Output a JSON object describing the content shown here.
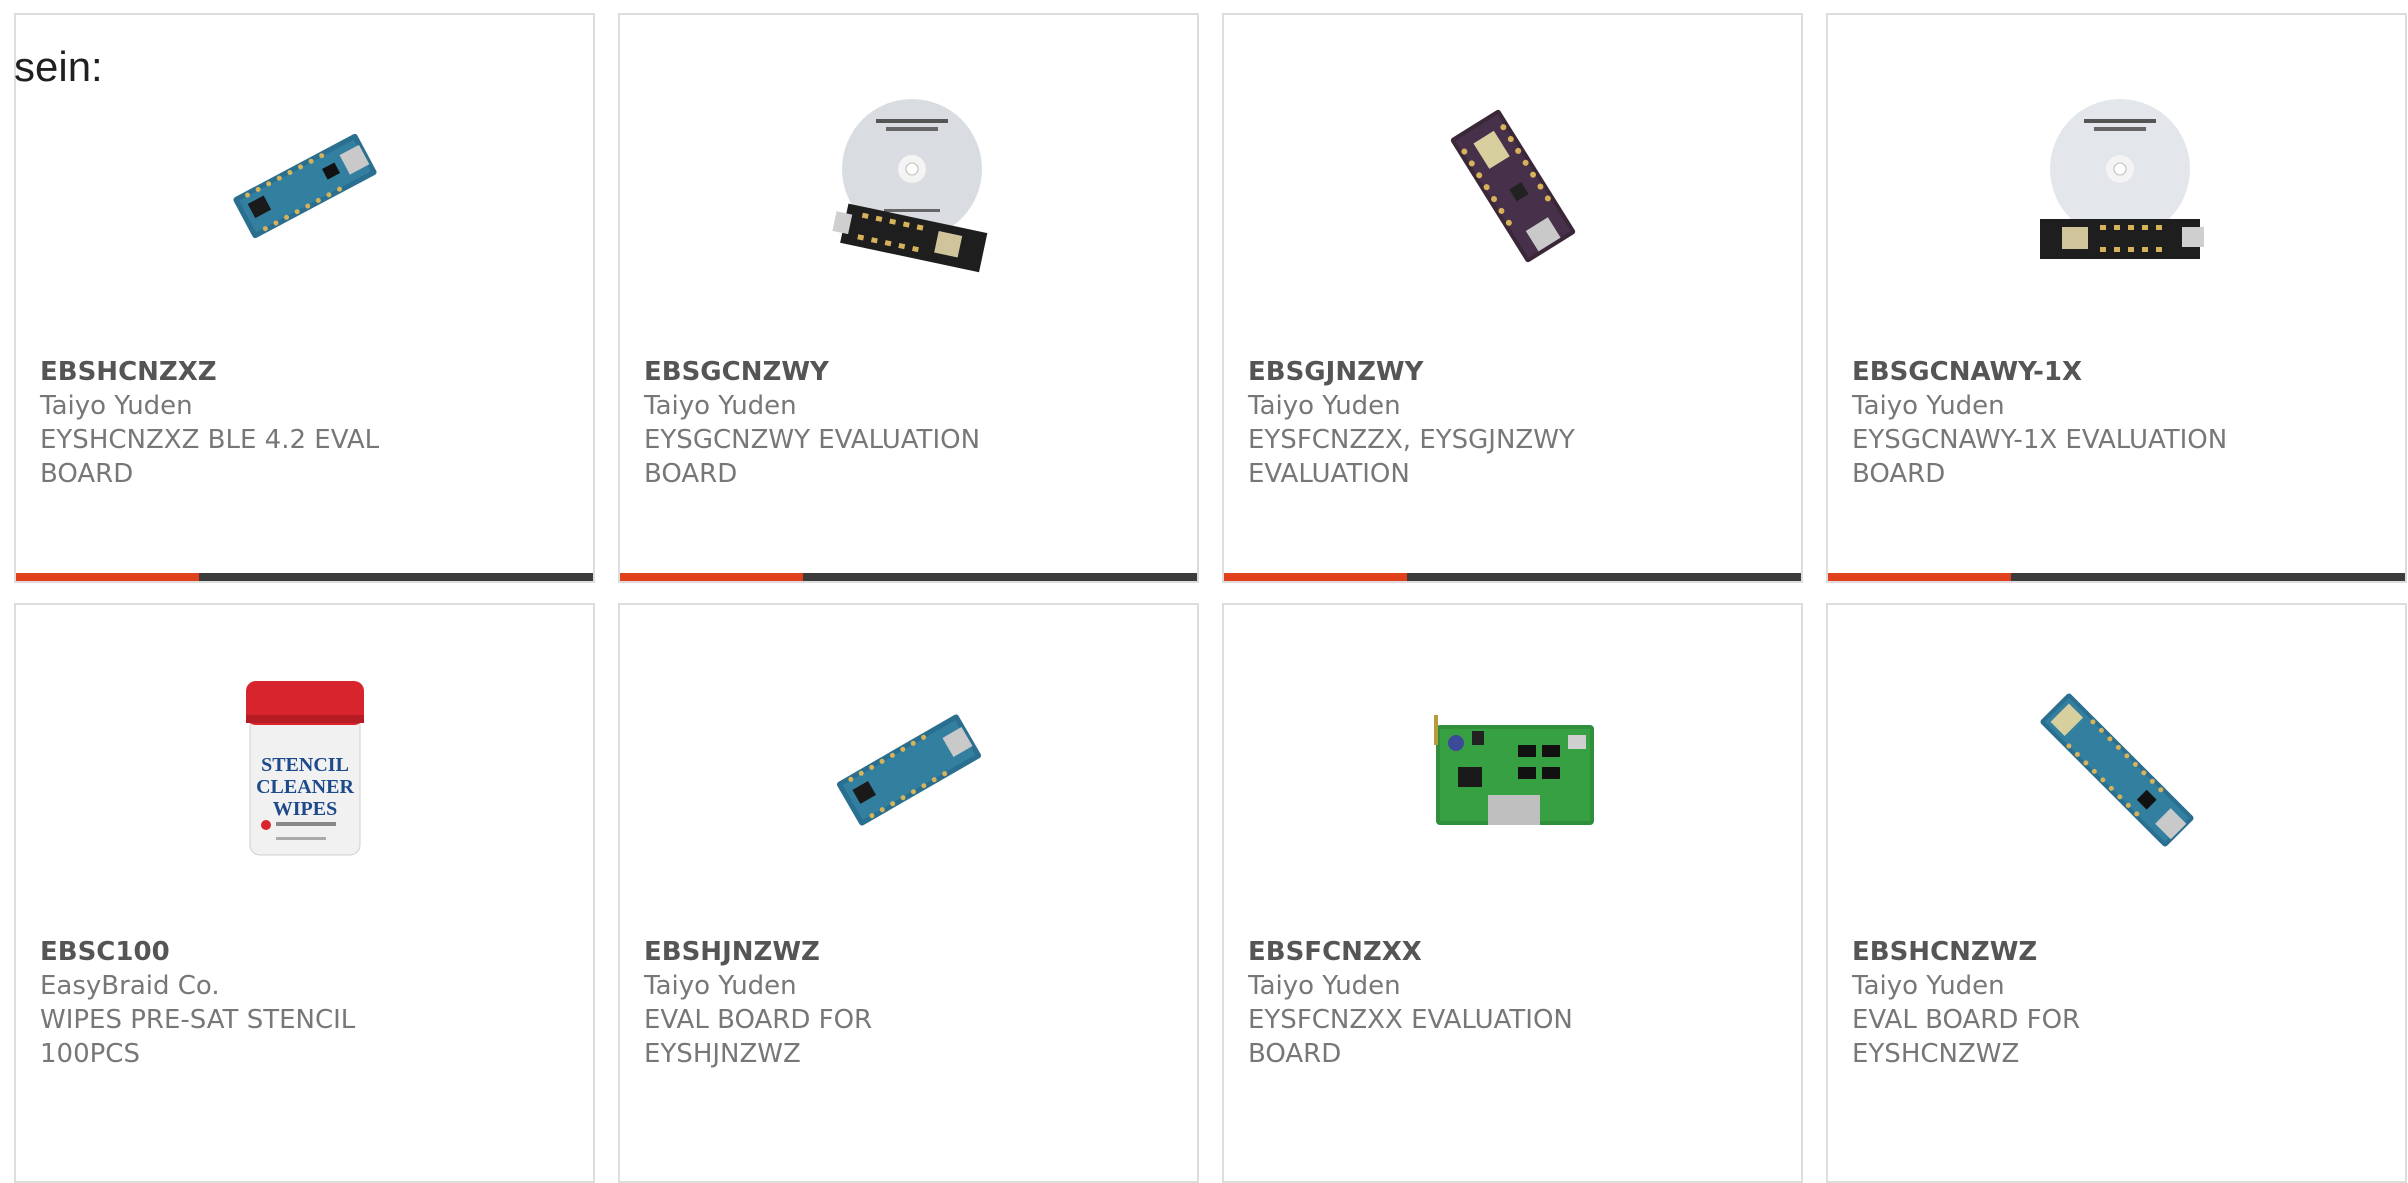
{
  "intro_text": "sein:",
  "colors": {
    "accent": "#e0401c",
    "bar": "#3c3c3c",
    "border": "#dddddd",
    "text": "#777777",
    "part_number": "#555555"
  },
  "products": [
    {
      "part_number": "EBSHCNZXZ",
      "manufacturer": "Taiyo Yuden",
      "description": "EYSHCNZXZ BLE 4.2 EVAL BOARD",
      "image_icon": "blue-eval-board-image",
      "show_accent_bar": true
    },
    {
      "part_number": "EBSGCNZWY",
      "manufacturer": "Taiyo Yuden",
      "description": "EYSGCNZWY EVALUATION BOARD",
      "image_icon": "cd-and-board-image",
      "show_accent_bar": true
    },
    {
      "part_number": "EBSGJNZWY",
      "manufacturer": "Taiyo Yuden",
      "description": "EYSFCNZZX, EYSGJNZWY EVALUATION",
      "image_icon": "purple-eval-board-image",
      "show_accent_bar": true
    },
    {
      "part_number": "EBSGCNAWY-1X",
      "manufacturer": "Taiyo Yuden",
      "description": "EYSGCNAWY-1X EVALUATION BOARD",
      "image_icon": "cd-and-board-image",
      "show_accent_bar": true
    },
    {
      "part_number": "EBSC100",
      "manufacturer": "EasyBraid Co.",
      "description": "WIPES PRE-SAT STENCIL 100PCS",
      "image_icon": "stencil-wipes-tub-image",
      "show_accent_bar": false
    },
    {
      "part_number": "EBSHJNZWZ",
      "manufacturer": "Taiyo Yuden",
      "description": "EVAL BOARD FOR EYSHJNZWZ",
      "image_icon": "blue-eval-board-image",
      "show_accent_bar": false
    },
    {
      "part_number": "EBSFCNZXX",
      "manufacturer": "Taiyo Yuden",
      "description": "EYSFCNZXX EVALUATION BOARD",
      "image_icon": "green-eval-board-image",
      "show_accent_bar": false
    },
    {
      "part_number": "EBSHCNZWZ",
      "manufacturer": "Taiyo Yuden",
      "description": "EVAL BOARD FOR EYSHCNZWZ",
      "image_icon": "long-blue-eval-board-image",
      "show_accent_bar": false
    }
  ]
}
